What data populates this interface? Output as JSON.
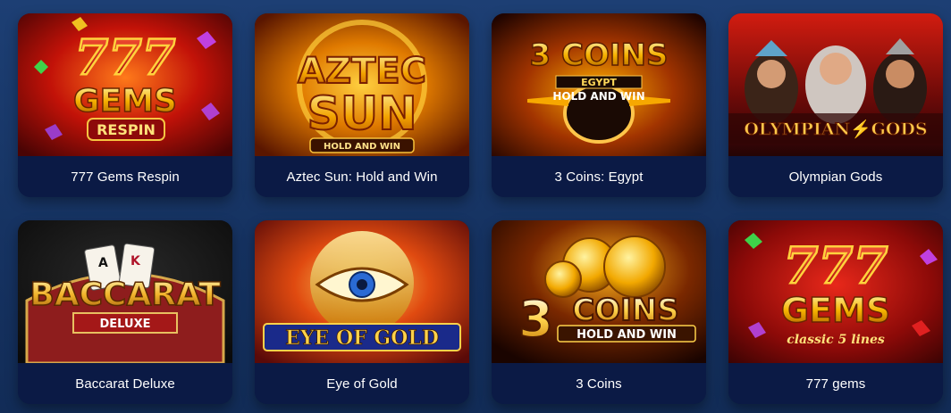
{
  "games": [
    {
      "caption": "777 Gems Respin",
      "art": {
        "line1": "777",
        "line2": "GEMS",
        "line3": "RESPIN"
      }
    },
    {
      "caption": "Aztec Sun: Hold and Win",
      "art": {
        "line1": "AZTEC",
        "line2": "SUN",
        "line3": "HOLD AND WIN"
      }
    },
    {
      "caption": "3 Coins: Egypt",
      "art": {
        "line1": "3",
        "line2": "COINS",
        "line3": "EGYPT",
        "line4": "HOLD AND WIN"
      }
    },
    {
      "caption": "Olympian Gods",
      "art": {
        "line1": "OLYMPIAN",
        "line2": "GODS"
      }
    },
    {
      "caption": "Baccarat Deluxe",
      "art": {
        "line1": "BACCARAT",
        "line2": "DELUXE"
      }
    },
    {
      "caption": "Eye of Gold",
      "art": {
        "line1": "EYE OF GOLD"
      }
    },
    {
      "caption": "3 Coins",
      "art": {
        "line1": "3",
        "line2": "COINS",
        "line3": "HOLD AND WIN"
      }
    },
    {
      "caption": "777 gems",
      "art": {
        "line1": "777",
        "line2": "GEMS",
        "line3": "classic 5 lines"
      }
    }
  ]
}
